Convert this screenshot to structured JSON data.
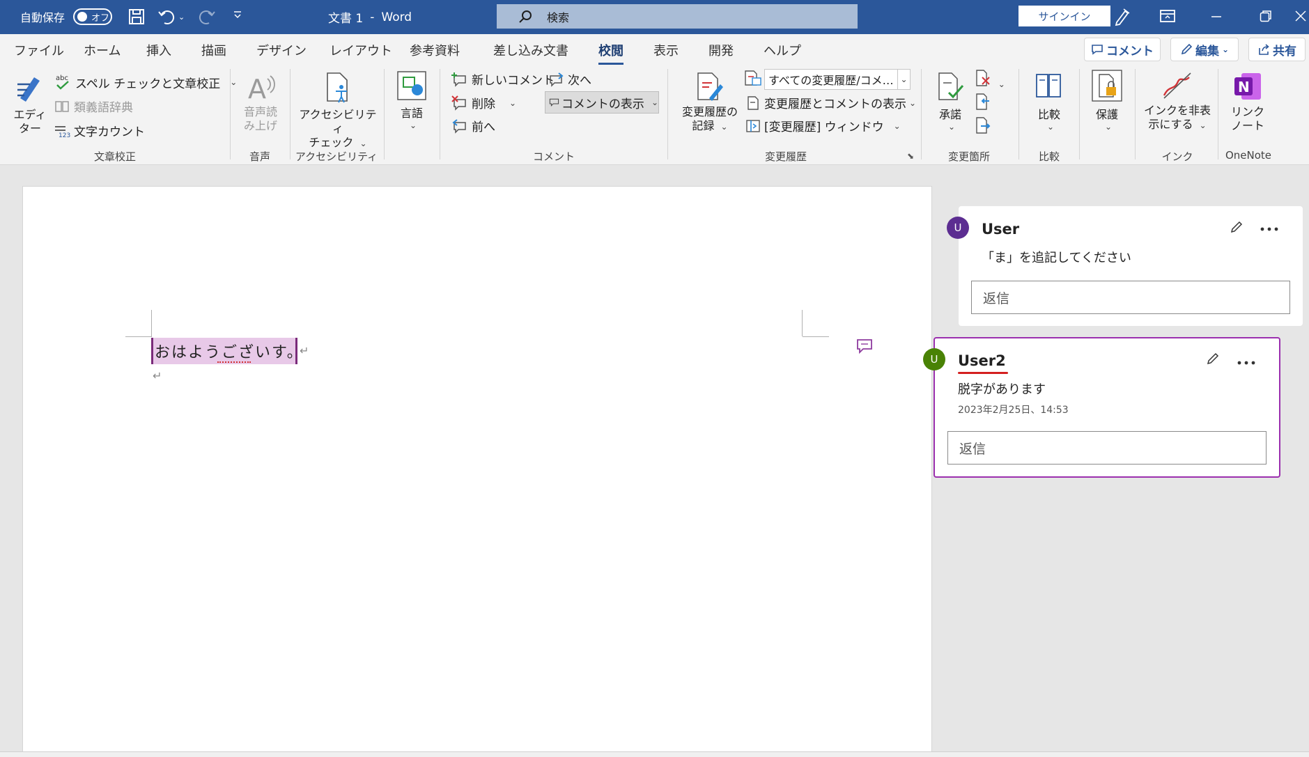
{
  "titlebar": {
    "autosave_label": "自動保存",
    "autosave_state": "オフ",
    "doc_title": "文書 1",
    "title_sep": "-",
    "app_name": "Word",
    "search_placeholder": "検索",
    "signin_label": "サインイン",
    "bg_color": "#2b579a"
  },
  "tabs": [
    {
      "label": "ファイル"
    },
    {
      "label": "ホーム"
    },
    {
      "label": "挿入"
    },
    {
      "label": "描画"
    },
    {
      "label": "デザイン"
    },
    {
      "label": "レイアウト"
    },
    {
      "label": "参考資料"
    },
    {
      "label": "差し込み文書"
    },
    {
      "label": "校閲",
      "active": true
    },
    {
      "label": "表示"
    },
    {
      "label": "開発"
    },
    {
      "label": "ヘルプ"
    }
  ],
  "top_buttons": {
    "comment": "コメント",
    "edit": "編集",
    "share": "共有"
  },
  "ribbon": {
    "proofing": {
      "group_label": "文章校正",
      "editor": "エディ\nター",
      "spell_check": "スペル チェックと文章校正",
      "thesaurus": "類義語辞典",
      "word_count": "文字カウント"
    },
    "speech": {
      "group_label": "音声",
      "read_aloud": "音声読\nみ上げ"
    },
    "accessibility": {
      "group_label": "アクセシビリティ",
      "check": "アクセシビリティ\nチェック"
    },
    "language": {
      "label": "言語"
    },
    "comments": {
      "group_label": "コメント",
      "new_comment": "新しいコメント",
      "delete": "削除",
      "previous": "前へ",
      "next": "次へ",
      "show_comments": "コメントの表示"
    },
    "tracking": {
      "group_label": "変更履歴",
      "track_changes": "変更履歴の\n記録",
      "markup_dropdown": "すべての変更履歴/コメ…",
      "show_markup": "変更履歴とコメントの表示",
      "reviewing_pane": "[変更履歴] ウィンドウ"
    },
    "changes": {
      "group_label": "変更箇所",
      "accept": "承諾"
    },
    "compare": {
      "group_label": "比較",
      "compare": "比較"
    },
    "protect": {
      "protect": "保護"
    },
    "ink": {
      "group_label": "インク",
      "hide_ink": "インクを非表\n示にする"
    },
    "onenote": {
      "group_label": "OneNote",
      "linked_notes": "リンク\nノート"
    }
  },
  "document": {
    "text": "おはようございす。",
    "para_mark": "↵"
  },
  "comments": [
    {
      "avatar": "U",
      "avatar_color": "#5c2d91",
      "author": "User",
      "body": "「ま」を追記してください",
      "reply_placeholder": "返信"
    },
    {
      "avatar": "U",
      "avatar_color": "#498205",
      "author": "User2",
      "body": "脱字があります",
      "date": "2023年2月25日、14:53",
      "reply_placeholder": "返信",
      "active_border": "#9b2fae"
    }
  ],
  "icons": {
    "save": "save-icon",
    "undo": "undo-icon",
    "redo": "redo-icon",
    "customize": "customize-qat-icon",
    "search": "search-icon",
    "pen": "pen-icon",
    "ribbon_display": "ribbon-display-icon",
    "minimize": "minimize-icon",
    "restore": "restore-icon",
    "close": "close-icon",
    "comment_marker": "comment-marker-icon",
    "edit": "edit-icon",
    "more": "more-icon"
  }
}
